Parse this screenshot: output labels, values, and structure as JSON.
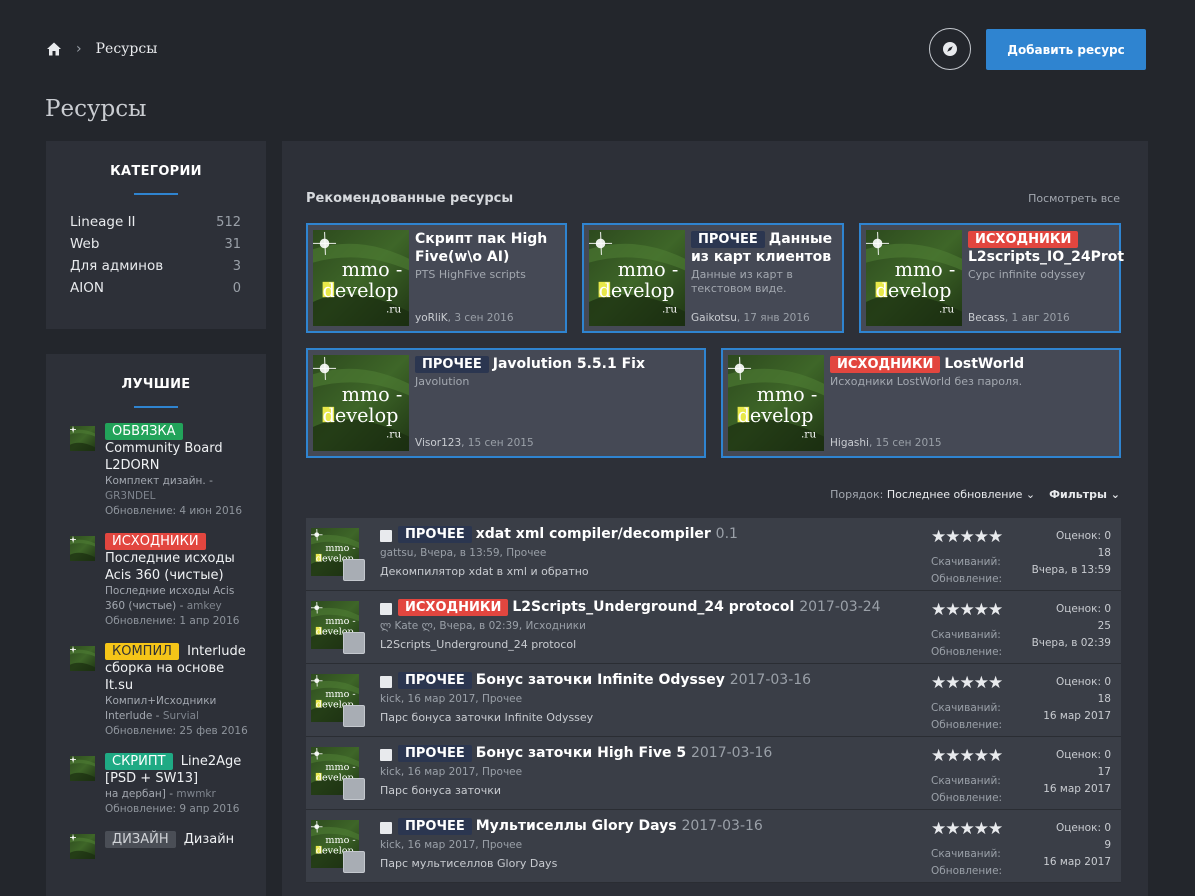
{
  "breadcrumb": {
    "current": "Ресурсы"
  },
  "header": {
    "title": "Ресурсы",
    "add_button": "Добавить ресурс"
  },
  "categories": {
    "heading": "КАТЕГОРИИ",
    "items": [
      {
        "name": "Lineage II",
        "count": "512"
      },
      {
        "name": "Web",
        "count": "31"
      },
      {
        "name": "Для админов",
        "count": "3"
      },
      {
        "name": "AION",
        "count": "0"
      }
    ]
  },
  "best": {
    "heading": "ЛУЧШИЕ",
    "items": [
      {
        "tag": "ОБВЯЗКА",
        "tag_color": "#22a35a",
        "title": "Community Board L2DORN",
        "desc": "Комплект дизайн. -",
        "author": "GR3NDEL",
        "updated": "Обновление: 4 июн 2016"
      },
      {
        "tag": "ИСХОДНИКИ",
        "tag_color": "#e2463f",
        "title": "Последние исходы Acis 360 (чистые)",
        "desc": "Последние исходы Acis 360 (чистые) -",
        "author": "amkey",
        "updated": "Обновление: 1 апр 2016"
      },
      {
        "tag": "КОМПИЛ",
        "tag_color": "#f5c518",
        "title": "Interlude сборка на основе It.su",
        "desc": "Компил+Исходники Interlude -",
        "author": "Survial",
        "updated": "Обновление: 25 фев 2016"
      },
      {
        "tag": "СКРИПТ",
        "tag_color": "#1faa84",
        "title": "Line2Age [PSD + SW13]",
        "desc": "на дербан] -",
        "author": "mwmkr",
        "updated": "Обновление: 9 апр 2016"
      },
      {
        "tag": "ДИЗАЙН",
        "tag_color": "#4a4e56",
        "title": "Дизайн",
        "desc": "",
        "author": "",
        "updated": ""
      }
    ]
  },
  "featured": {
    "heading": "Рекомендованные ресурсы",
    "view_all": "Посмотреть все",
    "cards": [
      {
        "tag": "",
        "title": "Скрипт пак High Five(w\\o AI)",
        "desc": "PTS HighFive scripts",
        "author": "yoRliK",
        "date": ", 3 сен 2016"
      },
      {
        "tag": "ПРОЧЕЕ",
        "title": "Данные из карт клиентов",
        "desc": "Данные из карт в текстовом виде.",
        "author": "Gaikotsu",
        "date": ", 17 янв 2016"
      },
      {
        "tag": "ИСХОДНИКИ",
        "title": "L2scripts_IO_24Prot",
        "desc": "Сурс infinite odyssey",
        "author": "Becass",
        "date": ", 1 авг 2016"
      },
      {
        "tag": "ПРОЧЕЕ",
        "title": "Javolution 5.5.1 Fix",
        "desc": "Javolution",
        "author": "Visor123",
        "date": ", 15 сен 2015"
      },
      {
        "tag": "ИСХОДНИКИ",
        "title": "LostWorld",
        "desc": "Исходники LostWorld без пароля.",
        "author": "Higashi",
        "date": ", 15 сен 2015"
      }
    ]
  },
  "sort": {
    "label": "Порядок:",
    "value": "Последнее обновление",
    "filters": "Фильтры"
  },
  "thumb_text": {
    "line1": "mmo -",
    "line2": "develop",
    "line3": ".ru"
  },
  "resources": [
    {
      "tag": "ПРОЧЕЕ",
      "title": "xdat xml compiler/decompiler",
      "version": "0.1",
      "meta": "gattsu, Вчера, в 13:59, Прочее",
      "desc": "Декомпилятор xdat в xml и обратно",
      "stars": "★★★★★",
      "ratings_label": "Оценок: 0",
      "downloads_label": "Скачиваний:",
      "downloads": "18",
      "updated_label": "Обновление:",
      "updated": "Вчера, в 13:59"
    },
    {
      "tag": "ИСХОДНИКИ",
      "title": "L2Scripts_Underground_24 protocol",
      "version": "2017-03-24",
      "meta": "ლ Kate ლ, Вчера, в 02:39, Исходники",
      "desc": "L2Scripts_Underground_24 protocol",
      "stars": "★★★★★",
      "ratings_label": "Оценок: 0",
      "downloads_label": "Скачиваний:",
      "downloads": "25",
      "updated_label": "Обновление:",
      "updated": "Вчера, в 02:39"
    },
    {
      "tag": "ПРОЧЕЕ",
      "title": "Бонус заточки Infinite Odyssey",
      "version": "2017-03-16",
      "meta": "kick, 16 мар 2017, Прочее",
      "desc": "Парс бонуса заточки Infinite Odyssey",
      "stars": "★★★★★",
      "ratings_label": "Оценок: 0",
      "downloads_label": "Скачиваний:",
      "downloads": "18",
      "updated_label": "Обновление:",
      "updated": "16 мар 2017"
    },
    {
      "tag": "ПРОЧЕЕ",
      "title": "Бонус заточки High Five 5",
      "version": "2017-03-16",
      "meta": "kick, 16 мар 2017, Прочее",
      "desc": "Парс бонуса заточки",
      "stars": "★★★★★",
      "ratings_label": "Оценок: 0",
      "downloads_label": "Скачиваний:",
      "downloads": "17",
      "updated_label": "Обновление:",
      "updated": "16 мар 2017"
    },
    {
      "tag": "ПРОЧЕЕ",
      "title": "Мультиселлы Glory Days",
      "version": "2017-03-16",
      "meta": "kick, 16 мар 2017, Прочее",
      "desc": "Парс мультиселлов Glory Days",
      "stars": "★★★★★",
      "ratings_label": "Оценок: 0",
      "downloads_label": "Скачиваний:",
      "downloads": "9",
      "updated_label": "Обновление:",
      "updated": "16 мар 2017"
    }
  ]
}
